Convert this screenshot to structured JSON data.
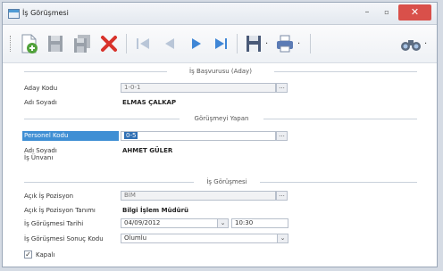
{
  "window": {
    "title": "İş Görüşmesi",
    "min_glyph": "–",
    "max_glyph": "▫",
    "close_glyph": "✕"
  },
  "toolbar": {
    "icons": [
      "new-document-icon",
      "save-icon",
      "save-all-icon",
      "delete-icon",
      "first-record-icon",
      "previous-record-icon",
      "next-record-icon",
      "last-record-icon",
      "save-dropdown-icon",
      "print-dropdown-icon",
      "find-icon"
    ],
    "dropdown_glyph": "·"
  },
  "sections": {
    "applicant": {
      "title": "İş Başvurusu (Aday)",
      "code_label": "Aday Kodu",
      "code_value": "1-0-1",
      "name_label": "Adı Soyadı",
      "name_value": "ELMAS ÇALKAP"
    },
    "interviewer": {
      "title": "Görüşmeyi Yapan",
      "staff_label": "Personel Kodu",
      "staff_value": "0-5",
      "name_label": "Adı Soyadı",
      "name_value": "AHMET GÜLER",
      "title_label": "İş Ünvanı"
    },
    "interview": {
      "title": "İş Görüşmesi",
      "position_label": "Açık İş Pozisyon",
      "position_value": "BİM",
      "desc_label": "Açık İş Pozisyon Tanımı",
      "desc_value": "Bilgi İşlem Müdürü",
      "date_label": "İş Görüşmesi Tarihi",
      "date_value": "04/09/2012",
      "time_value": "10:30",
      "result_label": "İş Görüşmesi Sonuç Kodu",
      "result_value": "Olumlu",
      "closed_label": "Kapalı",
      "closed_checked": "✓"
    }
  },
  "glyphs": {
    "ellipsis": "...",
    "dropdown": "⌄"
  }
}
